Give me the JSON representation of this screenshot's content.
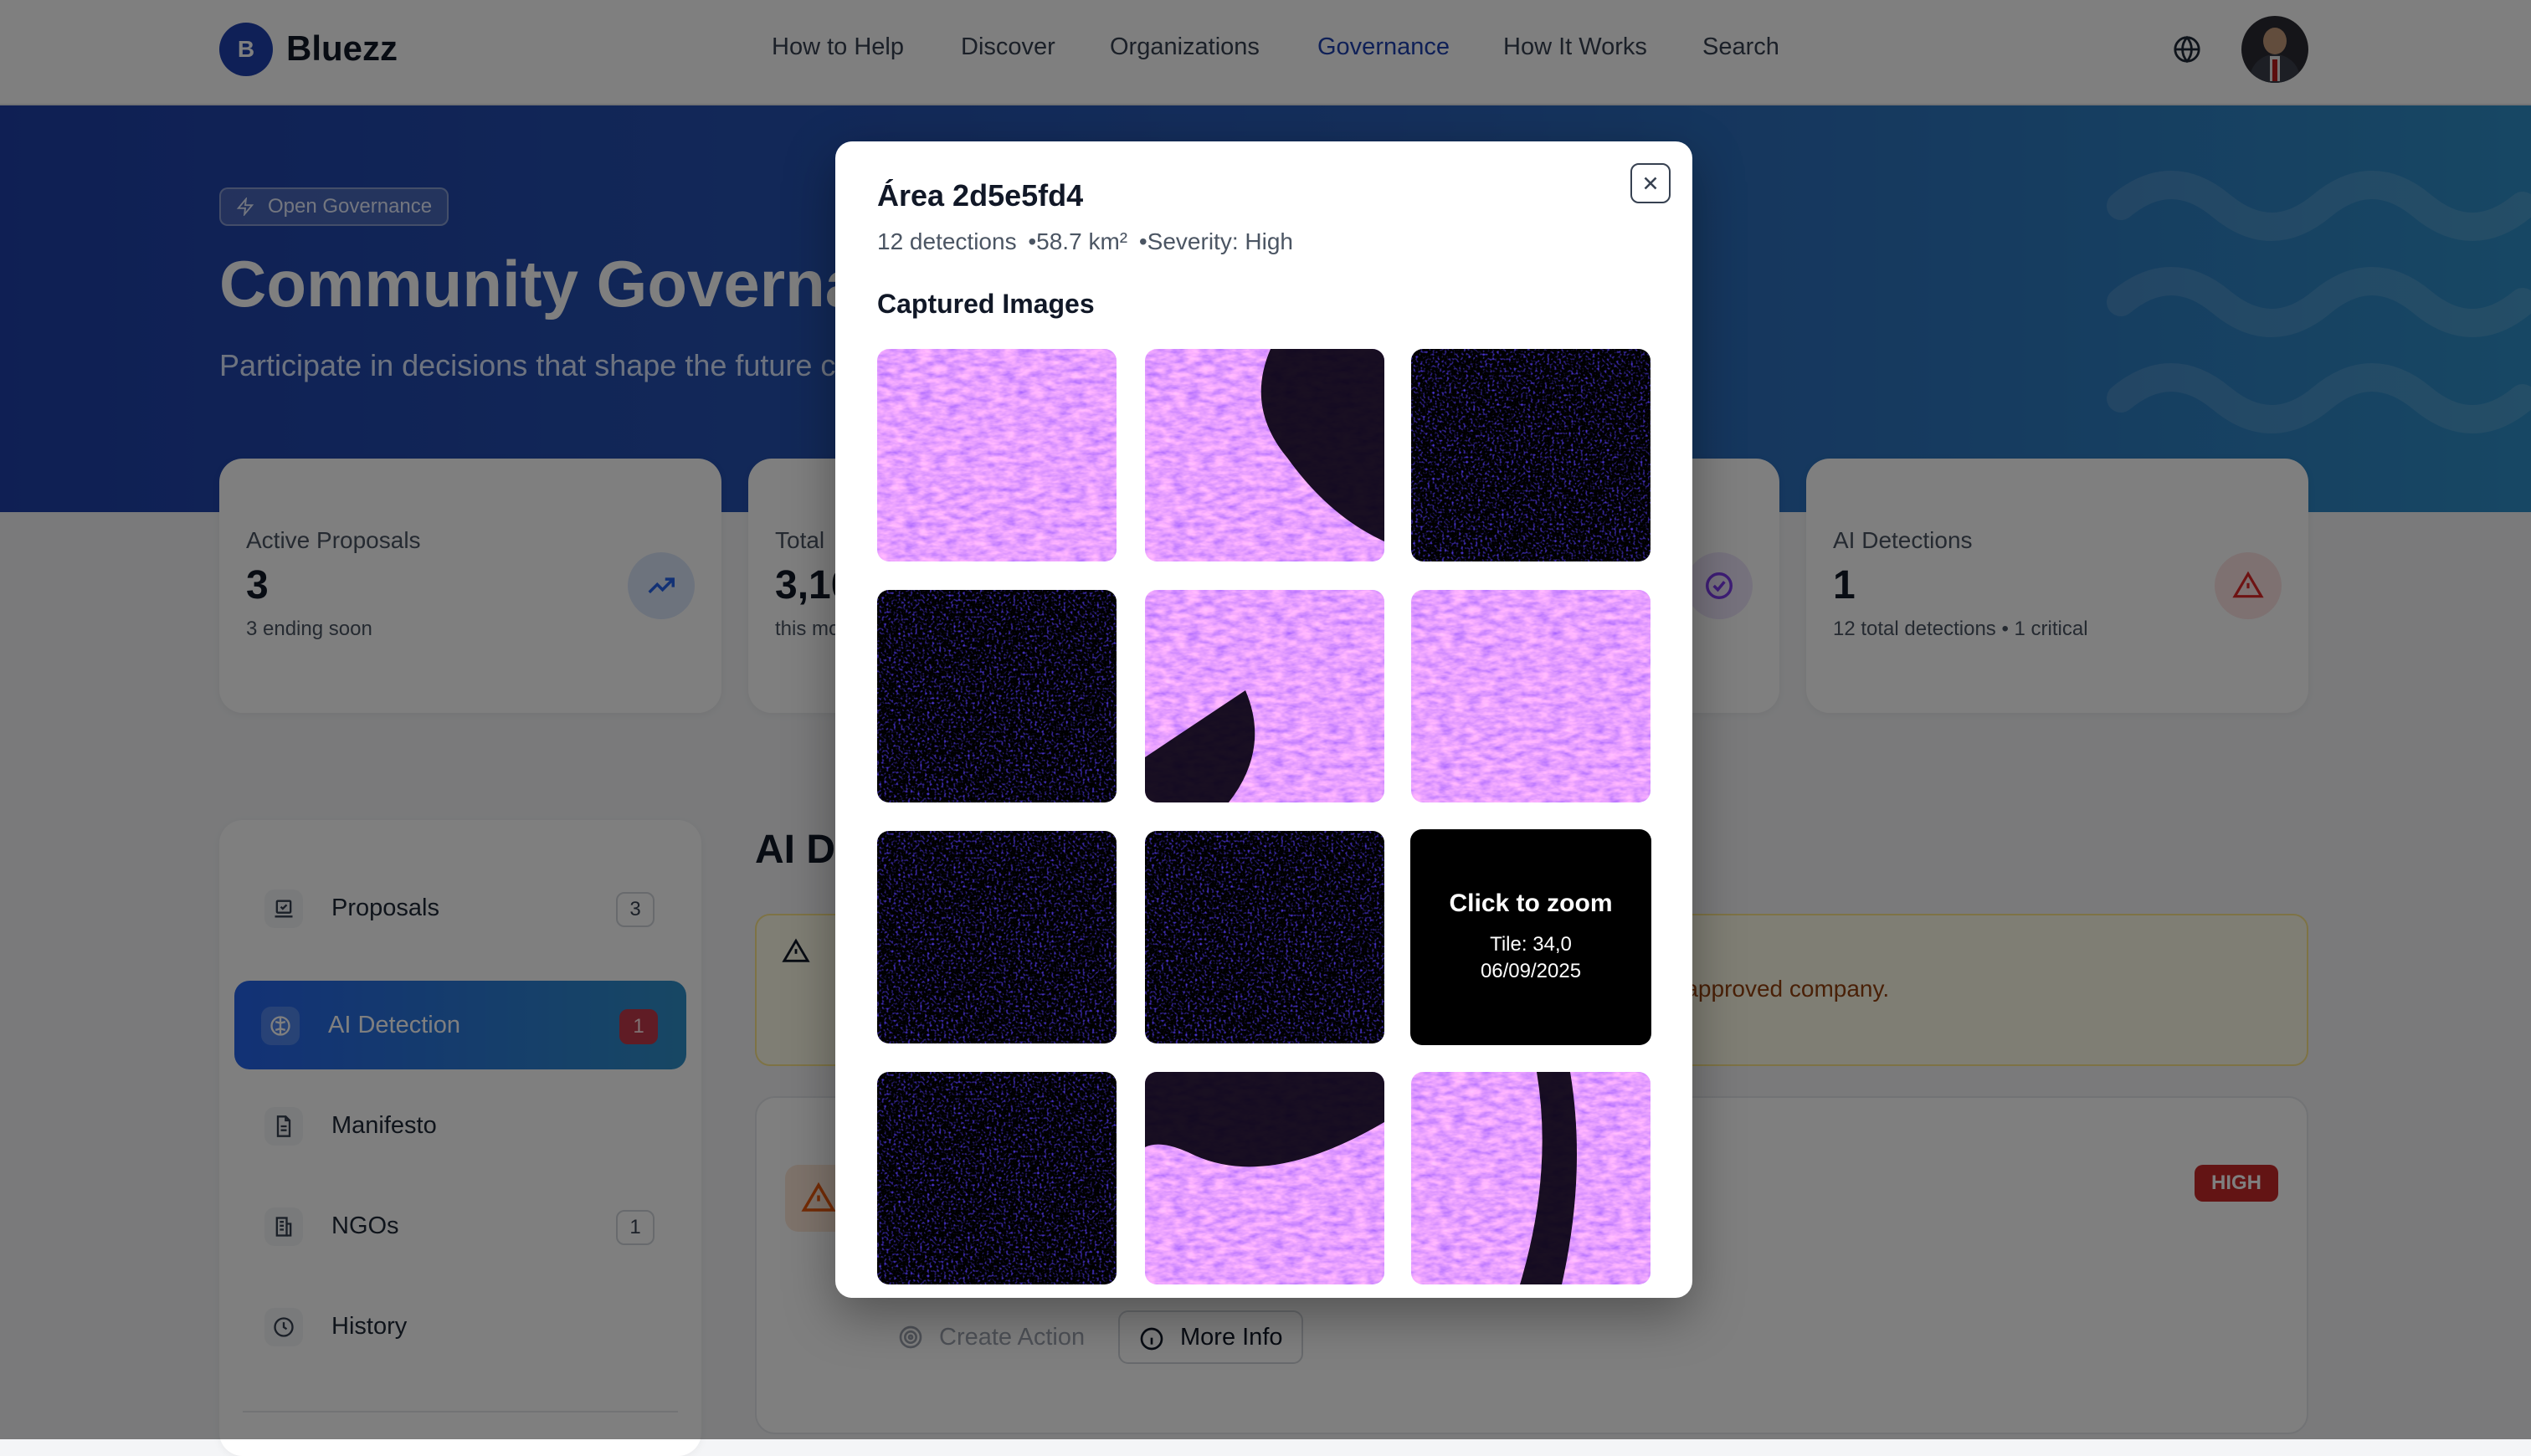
{
  "nav": {
    "logo_letter": "B",
    "brand": "Bluezz",
    "links": [
      "How to Help",
      "Discover",
      "Organizations",
      "Governance",
      "How It Works",
      "Search"
    ],
    "active_link": "Governance",
    "icons": [
      "globe-icon",
      "user-avatar"
    ]
  },
  "hero": {
    "tag": "Open Governance",
    "title": "Community Governance",
    "subtitle": "Participate in decisions that shape the future c"
  },
  "stats": [
    {
      "label": "Active Proposals",
      "value": "3",
      "note": "3 ending soon",
      "icon": "trending-up-icon"
    },
    {
      "label": "Total",
      "value": "3,10",
      "note": "this mo",
      "icon": ""
    },
    {
      "label": "",
      "value": "",
      "note": "",
      "icon": "check-circle-icon"
    },
    {
      "label": "AI Detections",
      "value": "1",
      "note": "12 total detections • 1 critical",
      "icon": "alert-triangle-icon"
    }
  ],
  "sidebar": {
    "items": [
      {
        "label": "Proposals",
        "count": "3",
        "icon": "ballot-icon",
        "active": false
      },
      {
        "label": "AI Detection",
        "count": "1",
        "icon": "brain-icon",
        "active": true
      },
      {
        "label": "Manifesto",
        "count": "",
        "icon": "document-icon",
        "active": false
      },
      {
        "label": "NGOs",
        "count": "1",
        "icon": "building-icon",
        "active": false
      },
      {
        "label": "History",
        "count": "",
        "icon": "clock-icon",
        "active": false
      }
    ]
  },
  "main": {
    "title": "AI De",
    "alert_text": "d approved company.",
    "badge": "HIGH",
    "buttons": {
      "create_action": "Create Action",
      "more_info": "More Info"
    }
  },
  "modal": {
    "title": "Área 2d5e5fd4",
    "detections": "12 detections",
    "area": "•58.7 km²",
    "severity": "•Severity: High",
    "section_title": "Captured Images",
    "hover_tile": {
      "title": "Click to zoom",
      "tile": "Tile: 34,0",
      "date": "06/09/2025"
    },
    "images": [
      "satellite-tile-1",
      "satellite-tile-2",
      "satellite-tile-3",
      "satellite-tile-4",
      "satellite-tile-5",
      "satellite-tile-6",
      "satellite-tile-7",
      "satellite-tile-8",
      "satellite-tile-9",
      "satellite-tile-10",
      "satellite-tile-11",
      "satellite-tile-12"
    ]
  },
  "colors": {
    "primary": "#1e40af",
    "hero_start": "#1e3fa8",
    "hero_end": "#2f8fc8",
    "danger": "#c62828",
    "warning_bg": "#fefce8"
  }
}
